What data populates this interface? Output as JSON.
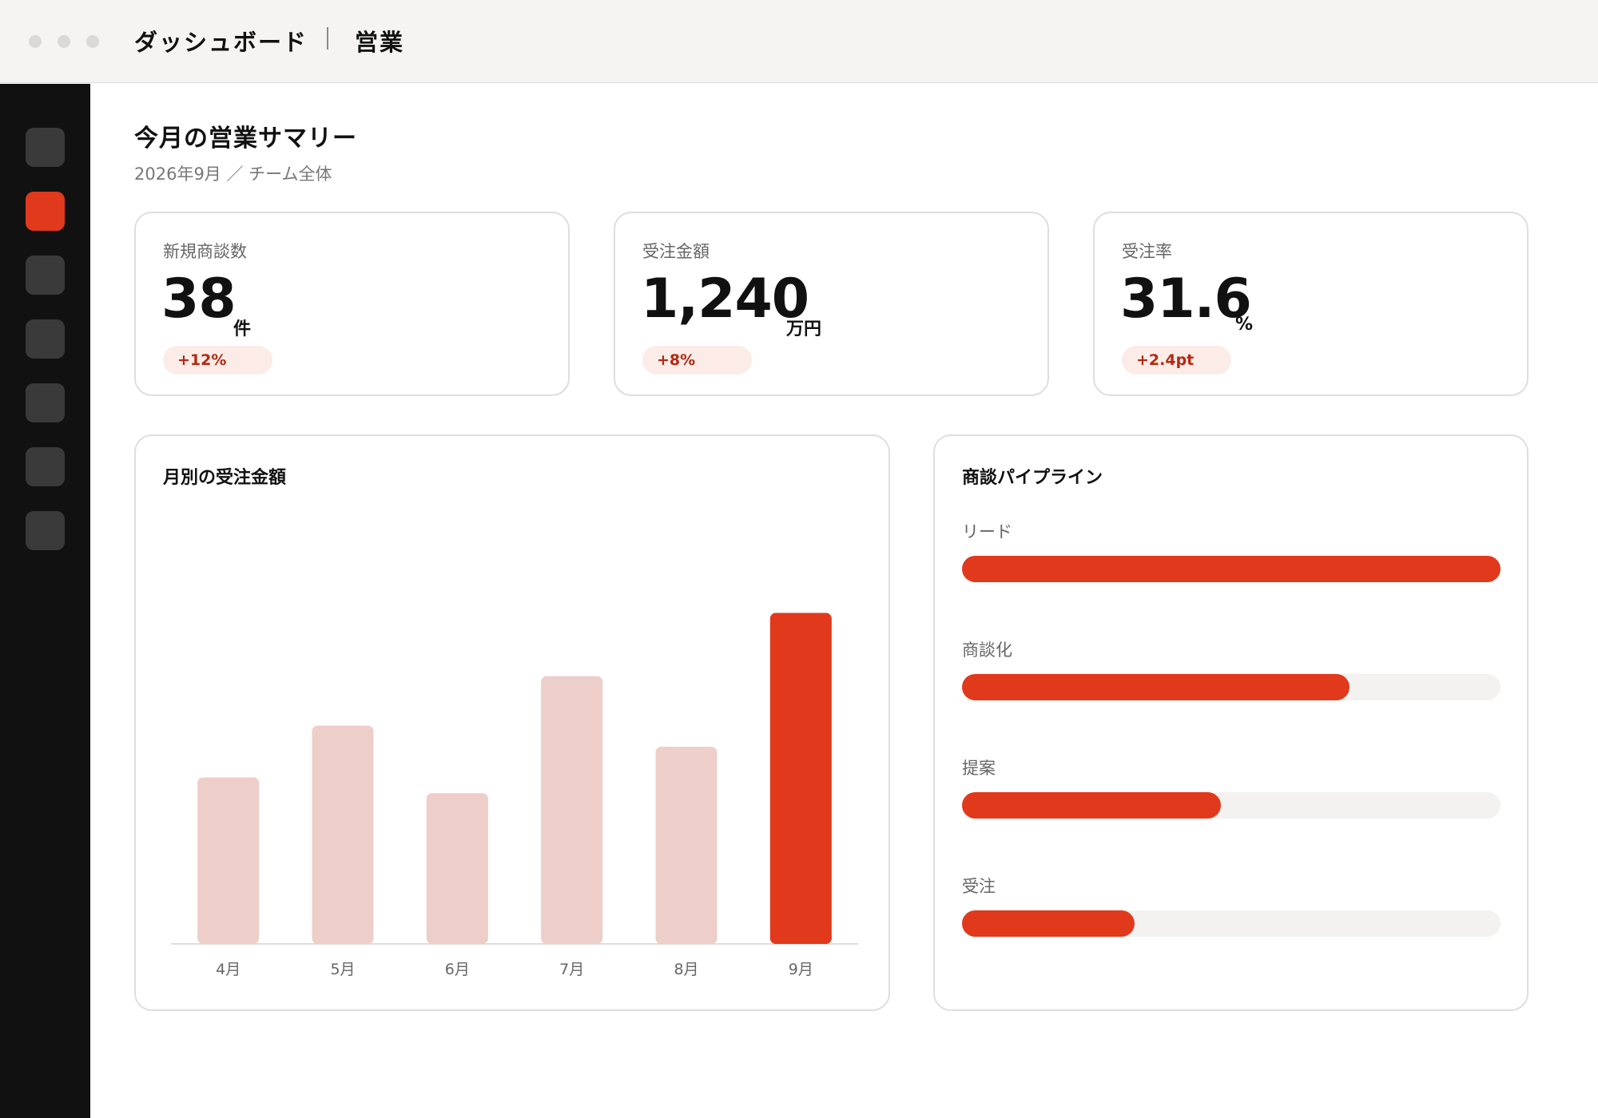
{
  "titlebar": {
    "title": "ダッシュボード",
    "section": "営業"
  },
  "sidebar": {
    "items": [
      {
        "icon": "nav-icon",
        "active": false
      },
      {
        "icon": "nav-icon",
        "active": true
      },
      {
        "icon": "nav-icon",
        "active": false
      },
      {
        "icon": "nav-icon",
        "active": false
      },
      {
        "icon": "nav-icon",
        "active": false
      },
      {
        "icon": "nav-icon",
        "active": false
      },
      {
        "icon": "nav-icon",
        "active": false
      }
    ]
  },
  "header": {
    "title": "今月の営業サマリー",
    "subtitle": "2026年9月 ／ チーム全体"
  },
  "kpis": [
    {
      "label": "新規商談数",
      "value": "38",
      "unit": "件",
      "delta": "+12%"
    },
    {
      "label": "受注金額",
      "value": "1,240",
      "unit": "万円",
      "delta": "+8%"
    },
    {
      "label": "受注率",
      "value": "31.6",
      "unit": "%",
      "delta": "+2.4pt"
    }
  ],
  "chart_panel": {
    "title": "月別の受注金額"
  },
  "chart_data": {
    "type": "bar",
    "title": "月別の受注金額",
    "categories": [
      "4月",
      "5月",
      "6月",
      "7月",
      "8月",
      "9月"
    ],
    "values": [
      790,
      1035,
      715,
      1270,
      935,
      1570
    ],
    "highlight_index": 5,
    "ylim": [
      0,
      2000
    ],
    "grid": false,
    "colors": {
      "default": "#eecec8",
      "highlight": "#e0391c",
      "axis": "#dddddd",
      "tick": "#666666"
    }
  },
  "pipeline": {
    "title": "商談パイプライン",
    "stages": [
      {
        "label": "リード",
        "fraction": 1.0
      },
      {
        "label": "商談化",
        "fraction": 0.72
      },
      {
        "label": "提案",
        "fraction": 0.48
      },
      {
        "label": "受注",
        "fraction": 0.32
      }
    ]
  },
  "colors": {
    "accent": "#e0391c",
    "accent_soft": "#fcece8",
    "sidebar": "#111111",
    "text_muted": "#666666"
  }
}
